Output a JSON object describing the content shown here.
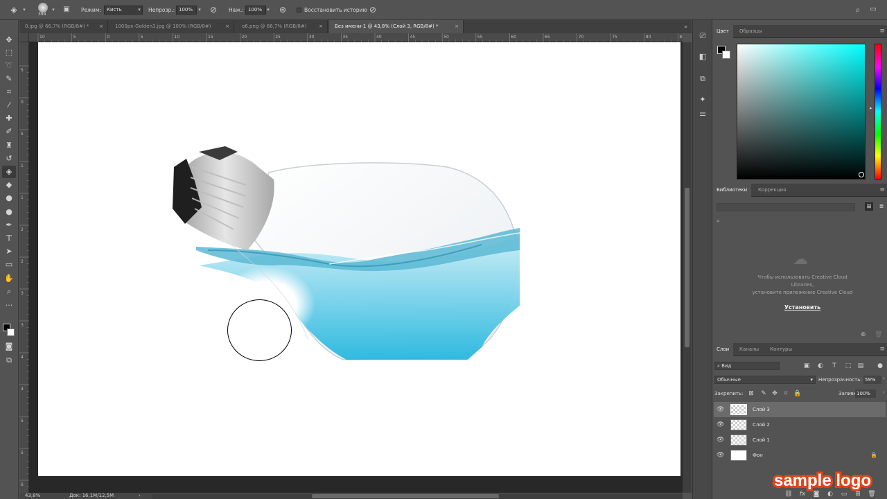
{
  "options_bar": {
    "brush_size": "394",
    "mode_label": "Режим:",
    "mode_value": "Кисть",
    "opacity_label": "Непрозр.:",
    "opacity_value": "100%",
    "flow_label": "Наж.:",
    "flow_value": "100%",
    "restore_history_label": "Восстановить историю"
  },
  "tabs": [
    {
      "label": "0.jpg @ 66,7% (RGB/8#) *"
    },
    {
      "label": "1000px-Golden3.jpg @ 100% (RGB/8#)"
    },
    {
      "label": "o6.png @ 66,7% (RGB/8#)"
    },
    {
      "label": "Без имени-1 @ 43,8% (Слой 3, RGB/8#) *",
      "active": true
    }
  ],
  "ruler": {
    "top_ticks": [
      "10",
      "5",
      "0",
      "5",
      "10",
      "15",
      "20",
      "25",
      "30",
      "35",
      "40",
      "45",
      "50",
      "55",
      "60",
      "65",
      "70",
      "75",
      "80",
      "85",
      "90",
      "95"
    ],
    "left_ticks": [
      "5",
      "0",
      "5",
      "1",
      "1",
      "2",
      "2",
      "3",
      "3",
      "4",
      "4",
      "5",
      "5",
      "6",
      "6"
    ]
  },
  "status": {
    "zoom": "43,8%",
    "doc": "Док: 16,1M/12,5M"
  },
  "color_panel": {
    "tabs": [
      "Цвет",
      "Образцы"
    ],
    "hue_color": "#00ffff"
  },
  "libraries_panel": {
    "tabs": [
      "Библиотеки",
      "Коррекция"
    ],
    "message_line1": "Чтобы использовать Creative Cloud",
    "message_line2": "Libraries,",
    "message_line3": "установите приложение Creative Cloud",
    "install_link": "Установить"
  },
  "layers_panel": {
    "tabs": [
      "Слои",
      "Каналы",
      "Контуры"
    ],
    "filter_kind": "Вид",
    "blend_mode": "Обычные",
    "opacity_label": "Непрозрачность:",
    "opacity_value": "59%",
    "lock_label": "Закрепить:",
    "fill_label": "Заливка:",
    "fill_value": "100%",
    "layers": [
      {
        "name": "Слой 3",
        "selected": true
      },
      {
        "name": "Слой 2"
      },
      {
        "name": "Слой 1"
      },
      {
        "name": "Фон",
        "locked": true
      }
    ]
  },
  "watermark": "sample logo"
}
